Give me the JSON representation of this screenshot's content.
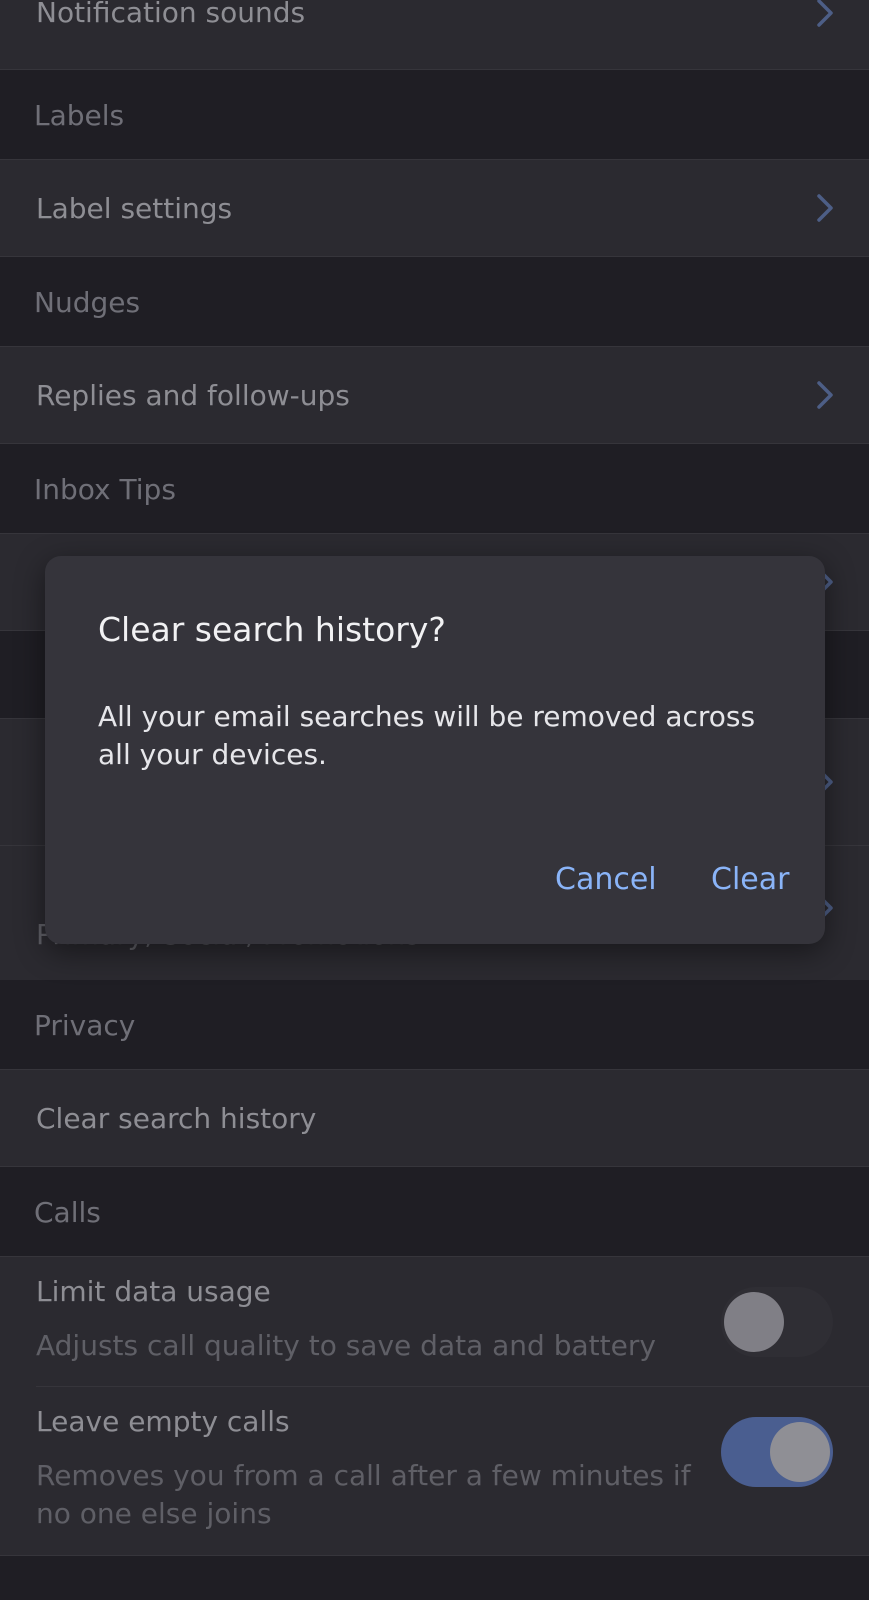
{
  "colors": {
    "background": "#1f1e24",
    "row_background": "#2b2a30",
    "accent": "#8ab4f8",
    "toggle_on_track": "#4a5e90"
  },
  "top_row": {
    "label": "Notification sounds"
  },
  "sections": {
    "labels": {
      "header": "Labels",
      "row_label": "Label settings"
    },
    "nudges": {
      "header": "Nudges",
      "row_label": "Replies and follow-ups"
    },
    "inbox_tips": {
      "header": "Inbox Tips"
    },
    "inbox_types_sub": "Primary, Social, Promotions",
    "privacy": {
      "header": "Privacy",
      "row_label": "Clear search history"
    },
    "calls": {
      "header": "Calls",
      "limit_data": {
        "label": "Limit data usage",
        "description": "Adjusts call quality to save data and battery",
        "enabled": false
      },
      "leave_empty": {
        "label": "Leave empty calls",
        "description_line1": "Removes you from a call after a few minutes if",
        "description_line2": "no one else joins",
        "enabled": true
      }
    }
  },
  "dialog": {
    "title": "Clear search history?",
    "body": "All your email searches will be removed across all your devices.",
    "cancel_label": "Cancel",
    "confirm_label": "Clear"
  }
}
